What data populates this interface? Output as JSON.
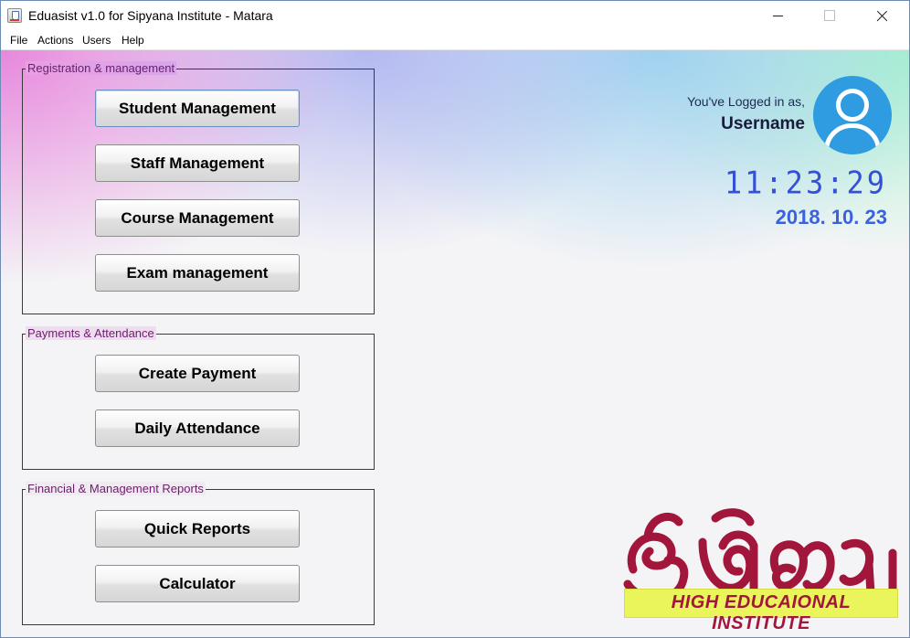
{
  "window": {
    "title": "Eduasist v1.0 for Sipyana Institute - Matara"
  },
  "menu": {
    "items": [
      {
        "label": "File"
      },
      {
        "label": "Actions"
      },
      {
        "label": "Users"
      },
      {
        "label": "Help"
      }
    ]
  },
  "groups": {
    "registration": {
      "title": "Registration & management",
      "buttons": [
        {
          "label": "Student Management"
        },
        {
          "label": "Staff Management"
        },
        {
          "label": "Course Management"
        },
        {
          "label": "Exam management"
        }
      ]
    },
    "payments": {
      "title": "Payments & Attendance",
      "buttons": [
        {
          "label": "Create Payment"
        },
        {
          "label": "Daily Attendance"
        }
      ]
    },
    "reports": {
      "title": "Financial & Management Reports",
      "buttons": [
        {
          "label": "Quick Reports"
        },
        {
          "label": "Calculator"
        }
      ]
    }
  },
  "user": {
    "logged_label": "You've Logged in as,",
    "username": "Username",
    "avatar_icon": "user-avatar-icon"
  },
  "clock": {
    "time": "11:23:29",
    "date": "2018. 10. 23"
  },
  "logo": {
    "script_text": "සිප්යානා",
    "tagline": "HIGH EDUCAIONAL INSTITUTE",
    "colors": {
      "script": "#a3163c",
      "banner": "#e9f55a"
    }
  },
  "colors": {
    "clock": "#3550d8",
    "group_title": "#6b1e6b",
    "avatar": "#2f9be0"
  }
}
